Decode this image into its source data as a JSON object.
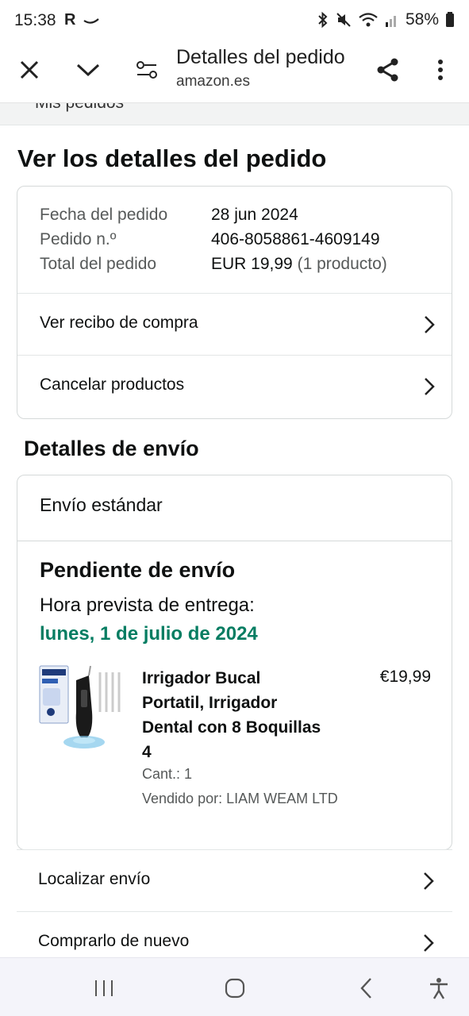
{
  "status_bar": {
    "time": "15:38",
    "r_label": "R",
    "battery": "58%"
  },
  "toolbar": {
    "title": "Detalles del pedido",
    "url": "amazon.es",
    "icons": [
      "close-icon",
      "chevron-down-icon",
      "tune-icon",
      "share-icon",
      "more-vert-icon"
    ]
  },
  "page": {
    "partial_label": "Mis pedidos",
    "heading": "Ver los detalles del pedido",
    "order_info": {
      "date_label": "Fecha del pedido",
      "date_value": "28 jun 2024",
      "number_label": "Pedido n.º",
      "number_value": "406-8058861-4609149",
      "total_label": "Total del pedido",
      "total_value": "EUR 19,99",
      "total_count": "(1 producto)"
    },
    "order_links": [
      {
        "label": "Ver recibo de compra"
      },
      {
        "label": "Cancelar productos"
      }
    ],
    "shipping": {
      "title": "Detalles de envío",
      "type": "Envío estándar",
      "status": "Pendiente de envío",
      "eta_label": "Hora prevista de entrega:",
      "eta_date": "lunes, 1 de julio de 2024",
      "eta_color": "#067d62",
      "product": {
        "name": "Irrigador Bucal Portatil, Irrigador Dental con 8 Boquillas 4",
        "price": "€19,99",
        "quantity": "Cant.: 1",
        "seller": "Vendido por: LIAM WEAM LTD"
      }
    },
    "actions": [
      {
        "label": "Localizar envío"
      },
      {
        "label": "Comprarlo de nuevo"
      }
    ]
  },
  "nav_bar": {
    "icons": [
      "recents-icon",
      "home-icon",
      "back-icon",
      "accessibility-icon"
    ]
  }
}
